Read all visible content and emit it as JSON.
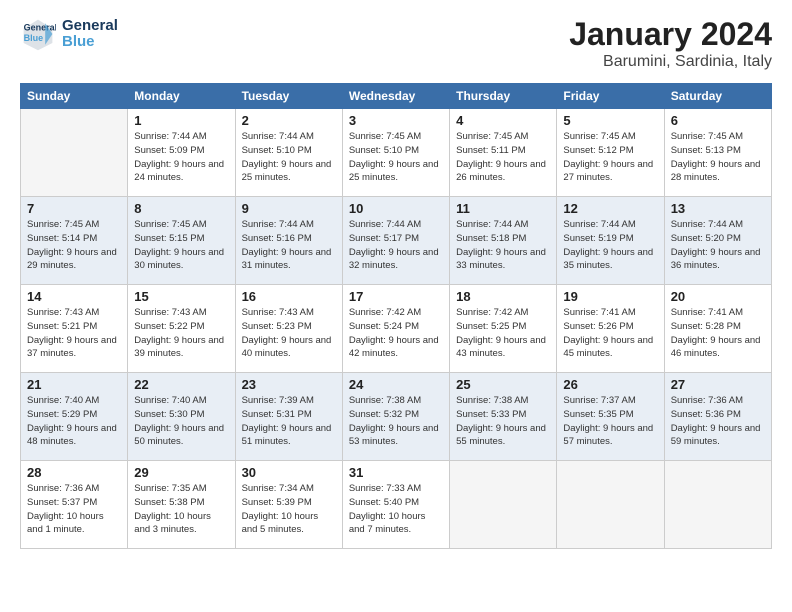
{
  "header": {
    "logo_line1": "General",
    "logo_line2": "Blue",
    "month": "January 2024",
    "location": "Barumini, Sardinia, Italy"
  },
  "columns": [
    "Sunday",
    "Monday",
    "Tuesday",
    "Wednesday",
    "Thursday",
    "Friday",
    "Saturday"
  ],
  "weeks": [
    [
      {
        "day": "",
        "sunrise": "",
        "sunset": "",
        "daylight": ""
      },
      {
        "day": "1",
        "sunrise": "Sunrise: 7:44 AM",
        "sunset": "Sunset: 5:09 PM",
        "daylight": "Daylight: 9 hours and 24 minutes."
      },
      {
        "day": "2",
        "sunrise": "Sunrise: 7:44 AM",
        "sunset": "Sunset: 5:10 PM",
        "daylight": "Daylight: 9 hours and 25 minutes."
      },
      {
        "day": "3",
        "sunrise": "Sunrise: 7:45 AM",
        "sunset": "Sunset: 5:10 PM",
        "daylight": "Daylight: 9 hours and 25 minutes."
      },
      {
        "day": "4",
        "sunrise": "Sunrise: 7:45 AM",
        "sunset": "Sunset: 5:11 PM",
        "daylight": "Daylight: 9 hours and 26 minutes."
      },
      {
        "day": "5",
        "sunrise": "Sunrise: 7:45 AM",
        "sunset": "Sunset: 5:12 PM",
        "daylight": "Daylight: 9 hours and 27 minutes."
      },
      {
        "day": "6",
        "sunrise": "Sunrise: 7:45 AM",
        "sunset": "Sunset: 5:13 PM",
        "daylight": "Daylight: 9 hours and 28 minutes."
      }
    ],
    [
      {
        "day": "7",
        "sunrise": "Sunrise: 7:45 AM",
        "sunset": "Sunset: 5:14 PM",
        "daylight": "Daylight: 9 hours and 29 minutes."
      },
      {
        "day": "8",
        "sunrise": "Sunrise: 7:45 AM",
        "sunset": "Sunset: 5:15 PM",
        "daylight": "Daylight: 9 hours and 30 minutes."
      },
      {
        "day": "9",
        "sunrise": "Sunrise: 7:44 AM",
        "sunset": "Sunset: 5:16 PM",
        "daylight": "Daylight: 9 hours and 31 minutes."
      },
      {
        "day": "10",
        "sunrise": "Sunrise: 7:44 AM",
        "sunset": "Sunset: 5:17 PM",
        "daylight": "Daylight: 9 hours and 32 minutes."
      },
      {
        "day": "11",
        "sunrise": "Sunrise: 7:44 AM",
        "sunset": "Sunset: 5:18 PM",
        "daylight": "Daylight: 9 hours and 33 minutes."
      },
      {
        "day": "12",
        "sunrise": "Sunrise: 7:44 AM",
        "sunset": "Sunset: 5:19 PM",
        "daylight": "Daylight: 9 hours and 35 minutes."
      },
      {
        "day": "13",
        "sunrise": "Sunrise: 7:44 AM",
        "sunset": "Sunset: 5:20 PM",
        "daylight": "Daylight: 9 hours and 36 minutes."
      }
    ],
    [
      {
        "day": "14",
        "sunrise": "Sunrise: 7:43 AM",
        "sunset": "Sunset: 5:21 PM",
        "daylight": "Daylight: 9 hours and 37 minutes."
      },
      {
        "day": "15",
        "sunrise": "Sunrise: 7:43 AM",
        "sunset": "Sunset: 5:22 PM",
        "daylight": "Daylight: 9 hours and 39 minutes."
      },
      {
        "day": "16",
        "sunrise": "Sunrise: 7:43 AM",
        "sunset": "Sunset: 5:23 PM",
        "daylight": "Daylight: 9 hours and 40 minutes."
      },
      {
        "day": "17",
        "sunrise": "Sunrise: 7:42 AM",
        "sunset": "Sunset: 5:24 PM",
        "daylight": "Daylight: 9 hours and 42 minutes."
      },
      {
        "day": "18",
        "sunrise": "Sunrise: 7:42 AM",
        "sunset": "Sunset: 5:25 PM",
        "daylight": "Daylight: 9 hours and 43 minutes."
      },
      {
        "day": "19",
        "sunrise": "Sunrise: 7:41 AM",
        "sunset": "Sunset: 5:26 PM",
        "daylight": "Daylight: 9 hours and 45 minutes."
      },
      {
        "day": "20",
        "sunrise": "Sunrise: 7:41 AM",
        "sunset": "Sunset: 5:28 PM",
        "daylight": "Daylight: 9 hours and 46 minutes."
      }
    ],
    [
      {
        "day": "21",
        "sunrise": "Sunrise: 7:40 AM",
        "sunset": "Sunset: 5:29 PM",
        "daylight": "Daylight: 9 hours and 48 minutes."
      },
      {
        "day": "22",
        "sunrise": "Sunrise: 7:40 AM",
        "sunset": "Sunset: 5:30 PM",
        "daylight": "Daylight: 9 hours and 50 minutes."
      },
      {
        "day": "23",
        "sunrise": "Sunrise: 7:39 AM",
        "sunset": "Sunset: 5:31 PM",
        "daylight": "Daylight: 9 hours and 51 minutes."
      },
      {
        "day": "24",
        "sunrise": "Sunrise: 7:38 AM",
        "sunset": "Sunset: 5:32 PM",
        "daylight": "Daylight: 9 hours and 53 minutes."
      },
      {
        "day": "25",
        "sunrise": "Sunrise: 7:38 AM",
        "sunset": "Sunset: 5:33 PM",
        "daylight": "Daylight: 9 hours and 55 minutes."
      },
      {
        "day": "26",
        "sunrise": "Sunrise: 7:37 AM",
        "sunset": "Sunset: 5:35 PM",
        "daylight": "Daylight: 9 hours and 57 minutes."
      },
      {
        "day": "27",
        "sunrise": "Sunrise: 7:36 AM",
        "sunset": "Sunset: 5:36 PM",
        "daylight": "Daylight: 9 hours and 59 minutes."
      }
    ],
    [
      {
        "day": "28",
        "sunrise": "Sunrise: 7:36 AM",
        "sunset": "Sunset: 5:37 PM",
        "daylight": "Daylight: 10 hours and 1 minute."
      },
      {
        "day": "29",
        "sunrise": "Sunrise: 7:35 AM",
        "sunset": "Sunset: 5:38 PM",
        "daylight": "Daylight: 10 hours and 3 minutes."
      },
      {
        "day": "30",
        "sunrise": "Sunrise: 7:34 AM",
        "sunset": "Sunset: 5:39 PM",
        "daylight": "Daylight: 10 hours and 5 minutes."
      },
      {
        "day": "31",
        "sunrise": "Sunrise: 7:33 AM",
        "sunset": "Sunset: 5:40 PM",
        "daylight": "Daylight: 10 hours and 7 minutes."
      },
      {
        "day": "",
        "sunrise": "",
        "sunset": "",
        "daylight": ""
      },
      {
        "day": "",
        "sunrise": "",
        "sunset": "",
        "daylight": ""
      },
      {
        "day": "",
        "sunrise": "",
        "sunset": "",
        "daylight": ""
      }
    ]
  ]
}
